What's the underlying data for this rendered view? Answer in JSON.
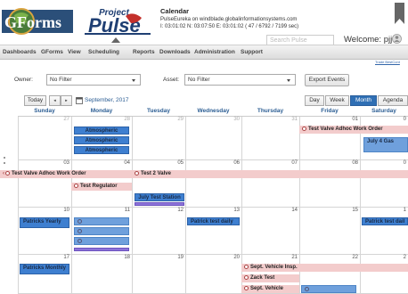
{
  "header": {
    "brand_left": "GForms",
    "brand_right": "Pulse",
    "title": "Calendar",
    "server": "PulseEureka on windblade.globalinformationsystems.com",
    "stats": "I: 03:01:02 N: 03:07:50 E: 03:01:02 ( 47 / 6792 / 7199 sec)",
    "search_placeholder": "Search Pulse",
    "welcome": "Welcome: pjj"
  },
  "nav": {
    "items": [
      "Dashboards",
      "GForms",
      "View",
      "Scheduling",
      "Reports",
      "Downloads",
      "Administration",
      "Support"
    ]
  },
  "trade_link": "Trade BestCont",
  "filters": {
    "owner_label": "Owner:",
    "owner_value": "No Filter",
    "asset_label": "Asset:",
    "asset_value": "No Filter",
    "export_label": "Export Events"
  },
  "toolbar": {
    "today": "Today",
    "prev": "◄",
    "next": "►",
    "month_label": "September, 2017",
    "views": [
      "Day",
      "Week",
      "Month",
      "Agenda"
    ],
    "active_view": "Month"
  },
  "calendar": {
    "day_names": [
      "Sunday",
      "Monday",
      "Tuesday",
      "Wednesday",
      "Thursday",
      "Friday",
      "Saturday"
    ],
    "weeks": [
      [
        "27",
        "28",
        "29",
        "30",
        "31",
        "01",
        "0"
      ],
      [
        "03",
        "04",
        "05",
        "06",
        "07",
        "08",
        "0"
      ],
      [
        "10",
        "11",
        "12",
        "13",
        "14",
        "15",
        "1"
      ],
      [
        "17",
        "18",
        "19",
        "20",
        "21",
        "22",
        "2"
      ]
    ],
    "events": {
      "atmospheric_1": "Atmospheric",
      "atmospheric_2": "Atmospheric",
      "atmospheric_3": "Atmospheric",
      "test_valve_adhoc_w1": "Test Valve Adhoc Work Order",
      "july_4_gas": "July 4 Gas",
      "test_valve_adhoc_w2": "Test Valve Adhoc Work Order",
      "test_2_valve": "Test 2 Valve",
      "test_regulator": "Test Regulator",
      "july_test_station": "July Test Station",
      "patricks_yearly": "Patricks Yearly",
      "patrick_test_daily_wed": "Patrick test daily",
      "patrick_test_daily_sat": "Patrick test dail",
      "patricks_monthly": "Patricks Monthly",
      "sept_vehicle_insp": "Sept. Vehicle Insp.",
      "zack_test": "Zack Test",
      "sept_vehicle": "Sept. Vehicle"
    }
  },
  "colors": {
    "event_blue": "#3e7fd0",
    "event_pink": "#f3cccc",
    "event_purple": "#8d73d9",
    "active_view": "#2f6fb4",
    "accent_text": "#2b5d93"
  }
}
